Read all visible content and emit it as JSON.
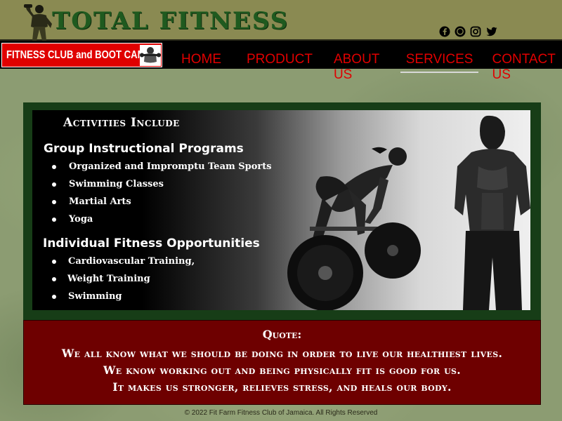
{
  "header": {
    "brand": "TOTAL FITNESS",
    "club_banner": "FITNESS CLUB and BOOT CAMP",
    "social_icons": [
      "facebook-icon",
      "whatsapp-icon",
      "instagram-icon",
      "twitter-icon"
    ]
  },
  "nav": {
    "items": [
      {
        "label": "HOME",
        "active": false
      },
      {
        "label": "PRODUCT",
        "active": false
      },
      {
        "label": "ABOUT US",
        "active": false
      },
      {
        "label": "SERVICES",
        "active": true
      },
      {
        "label": "CONTACT US",
        "active": false
      }
    ]
  },
  "activities": {
    "heading": "Activities Include",
    "group": {
      "title": "Group Instructional Programs",
      "items": [
        "Organized and Impromptu Team Sports",
        "Swimming Classes",
        "Martial Arts",
        "Yoga"
      ]
    },
    "individual": {
      "title": "Individual Fitness Opportunities",
      "items": [
        "Cardiovascular Training,",
        "Weight Training",
        "Swimming"
      ]
    }
  },
  "quote": {
    "title": "Quote:",
    "lines": [
      "We all know what we should be doing in order to live our healthiest lives.",
      "We know working out and being physically fit is good for us.",
      "It makes us stronger, relieves stress, and heals our body."
    ]
  },
  "footer": {
    "text": "©  2022 Fit Farm Fitness Club of Jamaica.  All Rights Reserved"
  },
  "colors": {
    "accent_red": "#e00000",
    "brand_green": "#1f5a1f",
    "quote_bg": "#6e0000",
    "panel_green": "#173d17"
  }
}
